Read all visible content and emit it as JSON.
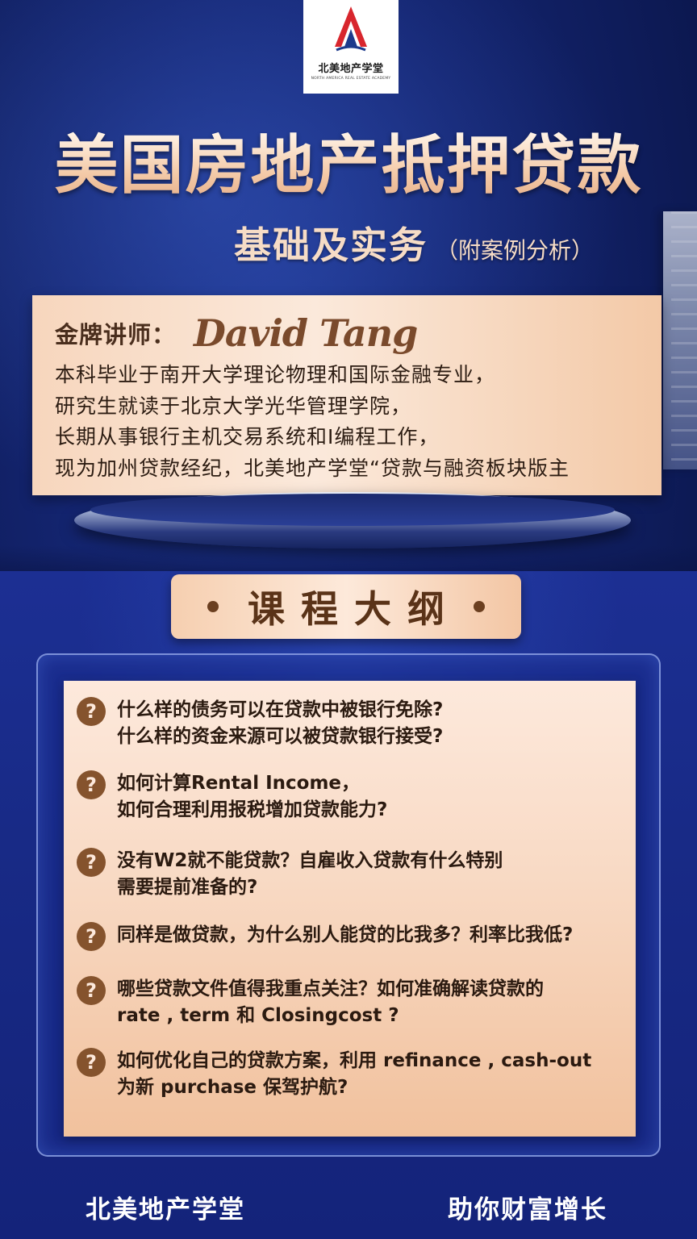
{
  "logo": {
    "name": "北美地产学堂",
    "subtitle": "NORTH AMERICA REAL ESTATE ACADEMY",
    "icon": "red-triangle-logo-icon"
  },
  "header": {
    "title": "美国房地产抵押贷款",
    "subtitle": "基础及实务",
    "subtitle_note": "（附案例分析）"
  },
  "instructor": {
    "role": "金牌讲师：",
    "name": "David Tang",
    "bio": [
      "本科毕业于南开大学理论物理和国际金融专业，",
      "研究生就读于北京大学光华管理学院，",
      "长期从事银行主机交易系统和I编程工作，",
      "现为加州贷款经纪，北美地产学堂“贷款与融资板块版主"
    ]
  },
  "outline": {
    "title": "课程大纲",
    "question_icon": "question-circle-icon",
    "questions": [
      [
        "什么样的债务可以在贷款中被银行免除?",
        "什么样的资金来源可以被贷款银行接受?"
      ],
      [
        "如何计算Rental Income，",
        "如何合理利用报税增加贷款能力?"
      ],
      [
        "没有W2就不能贷款？自雇收入贷款有什么特别",
        "需要提前准备的?"
      ],
      [
        "同样是做贷款，为什么别人能贷的比我多？利率比我低?"
      ],
      [
        "哪些贷款文件值得我重点关注？如何准确解读贷款的",
        "rate , term 和 Closingcost ?"
      ],
      [
        "如何优化自己的贷款方案，利用 refinance , cash-out",
        "为新 purchase 保驾护航?"
      ]
    ]
  },
  "footer": {
    "left": "北美地产学堂",
    "right": "助你财富增长"
  },
  "colors": {
    "background": "#142571",
    "accent_peach": "#f7d6bd",
    "brown": "#85532d",
    "logo_red": "#d8262d"
  }
}
